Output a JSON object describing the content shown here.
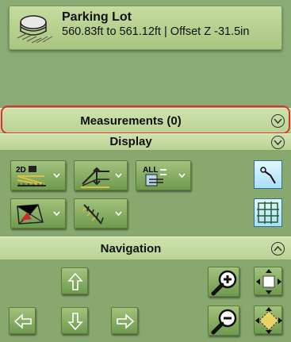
{
  "layer": {
    "name": "Parking Lot",
    "detail": "560.83ft to 561.12ft | Offset Z -31.5in",
    "icon": "surface-layers-icon"
  },
  "measurements": {
    "title": "Measurements (0)",
    "state": "collapsed"
  },
  "display": {
    "title": "Display",
    "state": "collapsed",
    "tools_row1": [
      "2d-linework-tool",
      "elevation-offset-tool",
      "all-layers-tool"
    ],
    "tools_row2": [
      "triangle-mesh-tool",
      "breakline-tool"
    ],
    "toggles": [
      "pin-measure-toggle",
      "grid-toggle"
    ],
    "active_toggle_color": "#a8dff7"
  },
  "navigation": {
    "title": "Navigation",
    "state": "expanded",
    "buttons": [
      "pan-up",
      "pan-left",
      "pan-down",
      "pan-right",
      "zoom-in",
      "zoom-out",
      "fit-extents",
      "rotate-view"
    ]
  },
  "colors": {
    "panel": "#88a870",
    "bar": "#c6dca0",
    "highlight": "#e03030"
  },
  "icon_labels": {
    "two_d": "2D",
    "all": "ALL"
  }
}
